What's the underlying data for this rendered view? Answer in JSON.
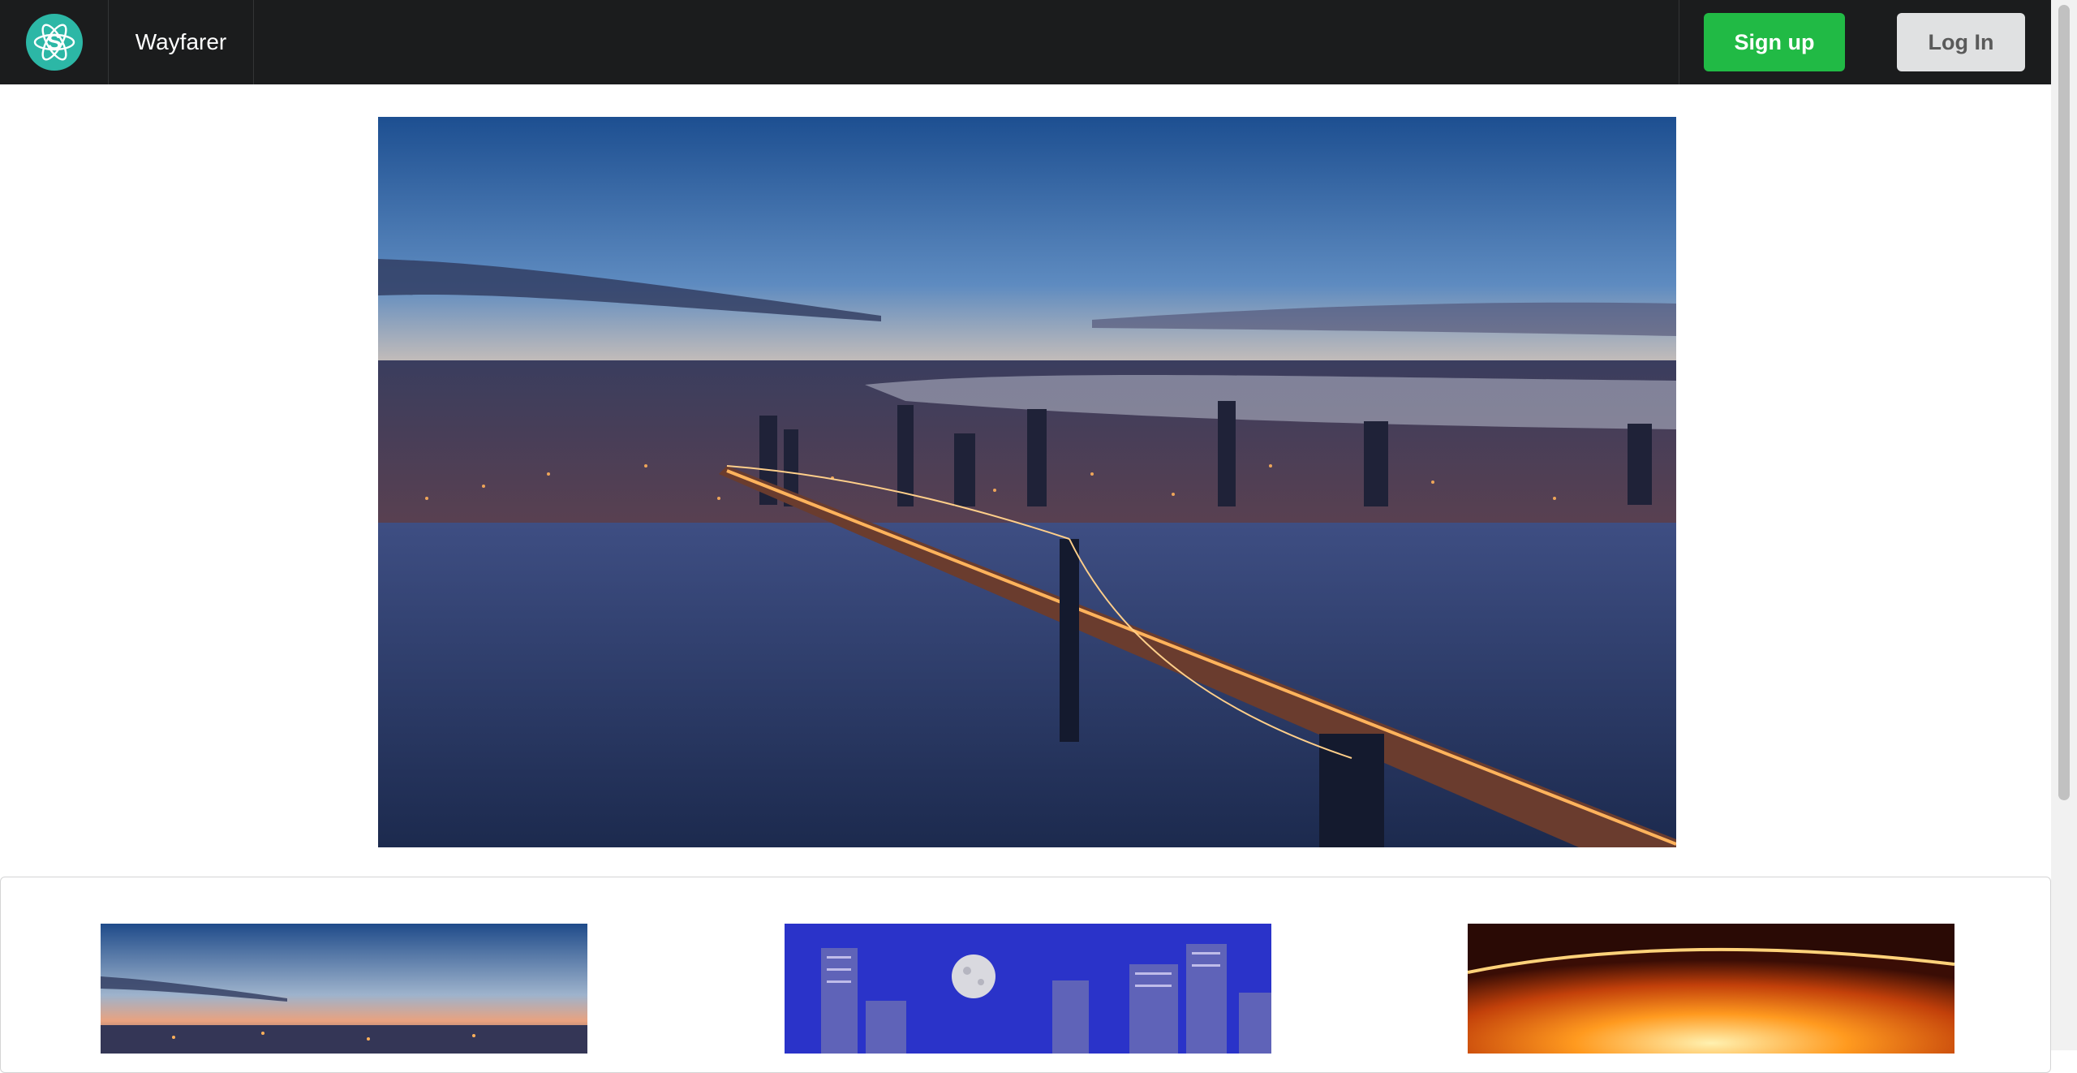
{
  "nav": {
    "brand": "Wayfarer",
    "logo_icon": "atom-icon",
    "signup_label": "Sign up",
    "login_label": "Log In"
  },
  "colors": {
    "navbar": "#1b1c1d",
    "logo": "#2cb7a6",
    "signup": "#21ba45",
    "login": "#e0e1e2"
  }
}
